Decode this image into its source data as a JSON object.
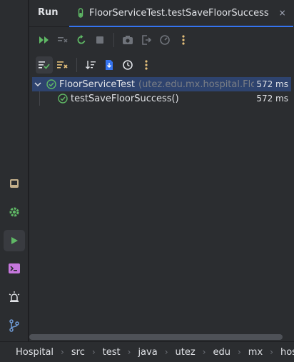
{
  "tool_window": {
    "title": "Run",
    "tab": {
      "label": "FloorServiceTest.testSaveFloorSuccess",
      "close": "×"
    }
  },
  "toolbar_primary": [
    "rerun-icon",
    "rerun-failed-icon",
    "restart-icon",
    "stop-icon",
    "camera-icon",
    "exit-icon",
    "debug-icon",
    "more-icon"
  ],
  "toolbar_secondary": [
    "show-passed-icon",
    "show-ignored-icon",
    "sort-icon",
    "export-icon",
    "history-icon",
    "more-icon"
  ],
  "tests": {
    "root": {
      "name": "FloorServiceTest",
      "package": "(utez.edu.mx.hospital.Floo",
      "duration": "572 ms",
      "status": "passed"
    },
    "children": [
      {
        "name": "testSaveFloorSuccess()",
        "duration": "572 ms",
        "status": "passed"
      }
    ]
  },
  "breadcrumb": [
    "Hospital",
    "src",
    "test",
    "java",
    "utez",
    "edu",
    "mx",
    "hosp"
  ],
  "colors": {
    "pass": "#5fb865",
    "accent": "#3574f0",
    "warning": "#e5c07b"
  }
}
